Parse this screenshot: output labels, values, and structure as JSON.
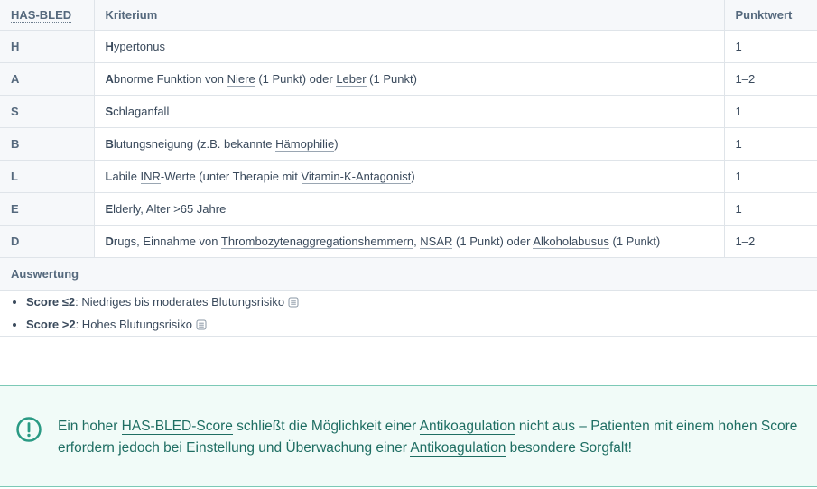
{
  "table": {
    "headers": {
      "abbr": "HAS-BLED",
      "criterion": "Kriterium",
      "points": "Punktwert"
    },
    "rows": [
      {
        "letter": "H",
        "segments": [
          {
            "t": "H",
            "b": true
          },
          {
            "t": "ypertonus"
          }
        ],
        "points": "1"
      },
      {
        "letter": "A",
        "segments": [
          {
            "t": "A",
            "b": true
          },
          {
            "t": "bnorme Funktion von "
          },
          {
            "t": "Niere",
            "u": true
          },
          {
            "t": " (1 Punkt) oder "
          },
          {
            "t": "Leber",
            "u": true
          },
          {
            "t": " (1 Punkt)"
          }
        ],
        "points": "1–2"
      },
      {
        "letter": "S",
        "segments": [
          {
            "t": "S",
            "b": true
          },
          {
            "t": "chlaganfall"
          }
        ],
        "points": "1"
      },
      {
        "letter": "B",
        "segments": [
          {
            "t": "B",
            "b": true
          },
          {
            "t": "lutungsneigung (z.B. bekannte "
          },
          {
            "t": "Hämophilie",
            "u": true
          },
          {
            "t": ")"
          }
        ],
        "points": "1"
      },
      {
        "letter": "L",
        "segments": [
          {
            "t": "L",
            "b": true
          },
          {
            "t": "abile "
          },
          {
            "t": "INR",
            "u": true
          },
          {
            "t": "-Werte (unter Therapie mit "
          },
          {
            "t": "Vitamin-K-Antagonist",
            "u": true
          },
          {
            "t": ")"
          }
        ],
        "points": "1"
      },
      {
        "letter": "E",
        "segments": [
          {
            "t": "E",
            "b": true
          },
          {
            "t": "lderly, Alter >65 Jahre"
          }
        ],
        "points": "1"
      },
      {
        "letter": "D",
        "segments": [
          {
            "t": "D",
            "b": true
          },
          {
            "t": "rugs, Einnahme von "
          },
          {
            "t": "Thrombozytenaggregationshemmern",
            "u": true
          },
          {
            "t": ", "
          },
          {
            "t": "NSAR",
            "u": true
          },
          {
            "t": " (1 Punkt) oder "
          },
          {
            "t": "Alkoholabusus",
            "u": true
          },
          {
            "t": " (1 Punkt)"
          }
        ],
        "points": "1–2"
      }
    ]
  },
  "evaluation": {
    "title": "Auswertung",
    "items": [
      {
        "score": "Score ≤2",
        "text": ": Niedriges bis moderates Blutungsrisiko",
        "icon": "note-icon"
      },
      {
        "score": "Score >2",
        "text": ": Hohes Blutungsrisiko",
        "icon": "note-icon"
      }
    ]
  },
  "callout": {
    "icon": "exclamation-circle-icon",
    "segments": [
      {
        "t": "Ein hoher "
      },
      {
        "t": "HAS-BLED-Score",
        "u": true
      },
      {
        "t": " schließt die Möglichkeit einer "
      },
      {
        "t": "Antikoagulation",
        "u": true
      },
      {
        "t": " nicht aus – Patienten mit einem hohen Score erfordern jedoch bei Einstellung und Überwachung einer "
      },
      {
        "t": "Antikoagulation",
        "u": true
      },
      {
        "t": " besondere Sorgfalt!"
      }
    ]
  },
  "colors": {
    "accent": "#1f6e63",
    "callout_bg": "#f1fbf8",
    "callout_border": "#7cc9b6"
  }
}
